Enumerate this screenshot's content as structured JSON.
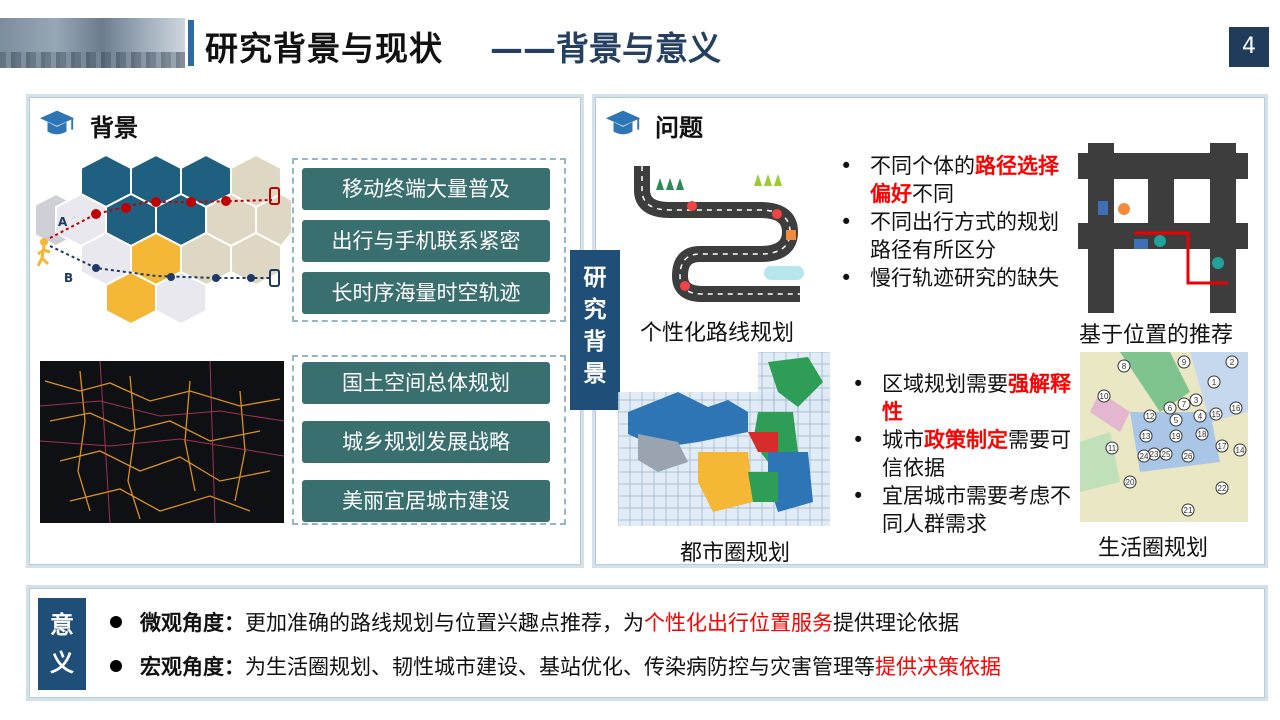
{
  "header": {
    "title": "研究背景与现状",
    "subtitle": "——背景与意义",
    "page_number": "4"
  },
  "background": {
    "title": "背景",
    "route_labels": {
      "a": "A",
      "b": "B"
    },
    "items_top": [
      "移动终端大量普及",
      "出行与手机联系紧密",
      "长时序海量时空轨迹"
    ],
    "items_bottom": [
      "国土空间总体规划",
      "城乡规划发展战略",
      "美丽宜居城市建设"
    ]
  },
  "center_label": [
    "研",
    "究",
    "背",
    "景"
  ],
  "issues": {
    "title": "问题",
    "bullets_top": [
      {
        "pre": "不同个体的",
        "red": "路径选择偏好",
        "post": "不同"
      },
      {
        "pre": "不同出行方式的规划路径有所区分",
        "red": "",
        "post": ""
      },
      {
        "pre": "慢行轨迹研究的缺失",
        "red": "",
        "post": ""
      }
    ],
    "bullets_bottom": [
      {
        "pre": "区域规划需要",
        "red": "强解释性",
        "post": ""
      },
      {
        "pre": "城市",
        "red": "政策制定",
        "post": "需要可信依据"
      },
      {
        "pre": "宜居城市需要考虑不同人群需求",
        "red": "",
        "post": ""
      }
    ],
    "captions": {
      "route": "个性化路线规划",
      "poi": "基于位置的推荐",
      "metro": "都市圈规划",
      "life": "生活圈规划"
    },
    "map_numbers": [
      "8",
      "9",
      "2",
      "10",
      "1",
      "3",
      "16",
      "7",
      "6",
      "4",
      "15",
      "12",
      "5",
      "13",
      "19",
      "18",
      "11",
      "23",
      "24",
      "25",
      "26",
      "17",
      "14",
      "20",
      "22",
      "21"
    ]
  },
  "significance": {
    "label": [
      "意",
      "义"
    ],
    "micro": {
      "head": "微观角度：",
      "pre": "更加准确的路线规划与位置兴趣点推荐，为",
      "red": "个性化出行位置服务",
      "post": "提供理论依据"
    },
    "macro": {
      "head": "宏观角度：",
      "pre": "为生活圈规划、韧性城市建设、基站优化、传染病防控与灾害管理等",
      "red": "提供决策依据",
      "post": ""
    }
  },
  "colors": {
    "accent": "#1f4e79",
    "pill": "#3a6f6f",
    "highlight": "#ff0000"
  }
}
